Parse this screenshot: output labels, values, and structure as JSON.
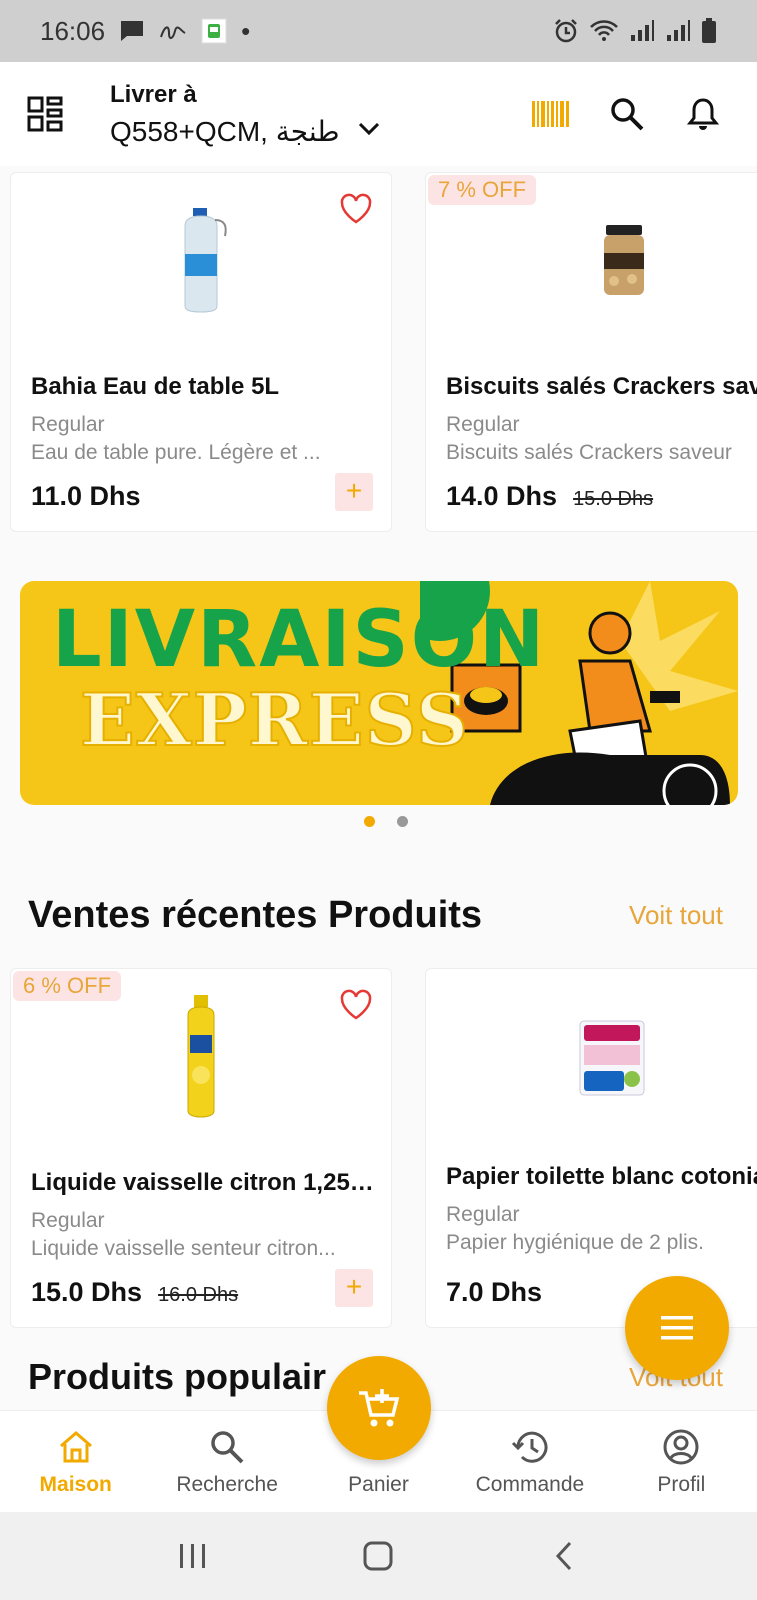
{
  "status_bar": {
    "time": "16:06",
    "dot": "•"
  },
  "header": {
    "deliver_label": "Livrer à",
    "address": "Q558+QCM, طنجة"
  },
  "products_top": [
    {
      "name": "Bahia Eau de table 5L",
      "variant": "Regular",
      "description": "Eau de table pure. Légère et ...",
      "price": "11.0 Dhs",
      "old_price": "",
      "discount": "",
      "favorite_icon": "heart-outline-icon"
    },
    {
      "name": "Biscuits salés Crackers saveu",
      "variant": "Regular",
      "description": "Biscuits salés Crackers saveur",
      "price": "14.0 Dhs",
      "old_price": "15.0 Dhs",
      "discount": "7 % OFF"
    }
  ],
  "banner": {
    "title": "LIVRAISON",
    "subtitle": "EXPRESS"
  },
  "carousel": {
    "count": 2,
    "active_index": 0
  },
  "recent_sales": {
    "title": "Ventes récentes Produits",
    "see_all": "Voit tout",
    "products": [
      {
        "name": "Liquide vaisselle citron 1,25L...",
        "variant": "Regular",
        "description": "Liquide vaisselle senteur citron...",
        "price": "15.0 Dhs",
        "old_price": "16.0 Dhs",
        "discount": "6 % OFF"
      },
      {
        "name": "Papier toilette blanc cotonia",
        "variant": "Regular",
        "description": "Papier hygiénique de 2 plis.",
        "price": "7.0 Dhs",
        "old_price": "",
        "discount": ""
      }
    ]
  },
  "popular": {
    "title": "Produits populair",
    "see_all": "Voit tout"
  },
  "add_symbol": "+",
  "bottom_nav": [
    {
      "label": "Maison",
      "icon": "home-icon",
      "active": true
    },
    {
      "label": "Recherche",
      "icon": "search-icon",
      "active": false
    },
    {
      "label": "Panier",
      "icon": "cart-icon",
      "active": false
    },
    {
      "label": "Commande",
      "icon": "history-icon",
      "active": false
    },
    {
      "label": "Profil",
      "icon": "profile-icon",
      "active": false
    }
  ],
  "colors": {
    "accent": "#f2a900",
    "accent_text": "#e8a53a",
    "discount_bg": "#fde4e4",
    "banner_green": "#17a34a",
    "banner_yellow": "#f5c617",
    "heart": "#e53935"
  }
}
